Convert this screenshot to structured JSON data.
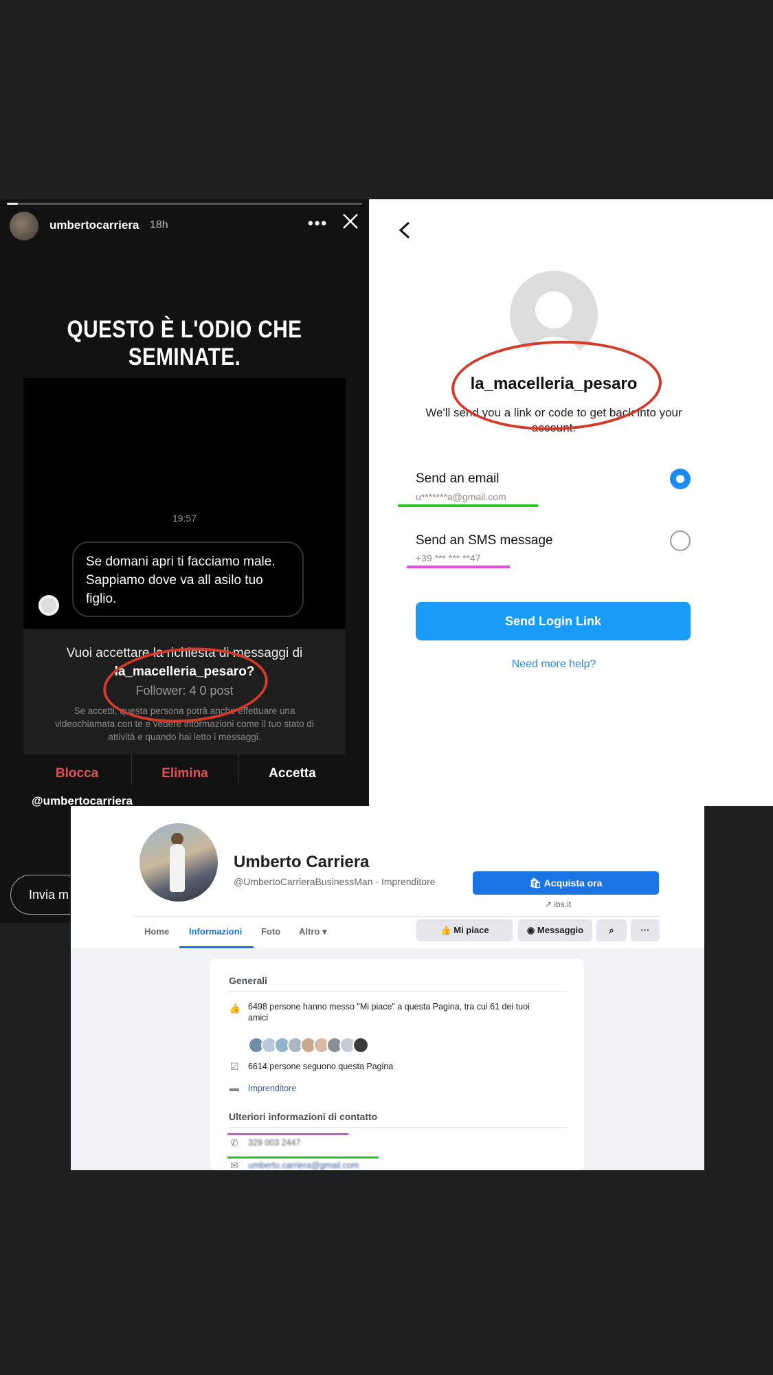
{
  "story": {
    "username": "umbertocarriera",
    "time": "18h",
    "more": "•••",
    "headline": "QUESTO È L'ODIO CHE SEMINATE.",
    "dm": {
      "timestamp": "19:57",
      "message": "Se domani apri ti facciamo male. Sappiamo dove va all asilo tuo figlio.",
      "request_prefix": "Vuoi accettare la richiesta di messaggi di",
      "request_user": "la_macelleria_pesaro?",
      "followers": "Follower: 4 0 post",
      "info": "Se accetti, questa persona potrà anche effettuare una videochiamata con te e vedere informazioni come il tuo stato di attività e quando hai letto i messaggi.",
      "buttons": {
        "block": "Blocca",
        "delete": "Elimina",
        "accept": "Accetta"
      }
    },
    "handle": "@umbertocarriera",
    "send_message": "Invia m"
  },
  "recover": {
    "username": "la_macelleria_pesaro",
    "subtitle": "We'll send you a link or code to get back into your account.",
    "options": [
      {
        "label": "Send an email",
        "detail": "u*******a@gmail.com",
        "selected": true
      },
      {
        "label": "Send an SMS message",
        "detail": "+39 *** *** **47",
        "selected": false
      }
    ],
    "send_button": "Send Login Link",
    "help_link": "Need more help?"
  },
  "facebook": {
    "page_name": "Umberto Carriera",
    "handle_line": "@UmbertoCarrieraBusinessMan · Imprenditore",
    "buy_button": "Acquista ora",
    "website": "ibs.it",
    "tabs": [
      "Home",
      "Informazioni",
      "Foto",
      "Altro"
    ],
    "active_tab": "Informazioni",
    "like_button": "Mi piace",
    "message_button": "Messaggio",
    "more_button": "···",
    "general_heading": "Generali",
    "likes_text": "6498 persone hanno messo \"Mi piace\" a questa Pagina, tra cui 61 dei tuoi amici",
    "followers_text": "6614 persone seguono questa Pagina",
    "category": "Imprenditore",
    "contact_heading": "Ulteriori informazioni di contatto",
    "phone": "329 003 2447",
    "email": "umberto.carriera@gmail.com",
    "friend_colors": [
      "#6f8fa8",
      "#b7c9d6",
      "#8fb3cf",
      "#a9b6c4",
      "#c9a88d",
      "#d7b9a5",
      "#8a8f9a",
      "#c5cbd4",
      "#3b3b3b"
    ]
  },
  "colors": {
    "annotation_red": "#d33a2a",
    "annotation_green": "#2dc22d",
    "annotation_magenta": "#e14fe1",
    "instagram_blue": "#1a9bf6",
    "facebook_blue": "#1b74e4"
  }
}
